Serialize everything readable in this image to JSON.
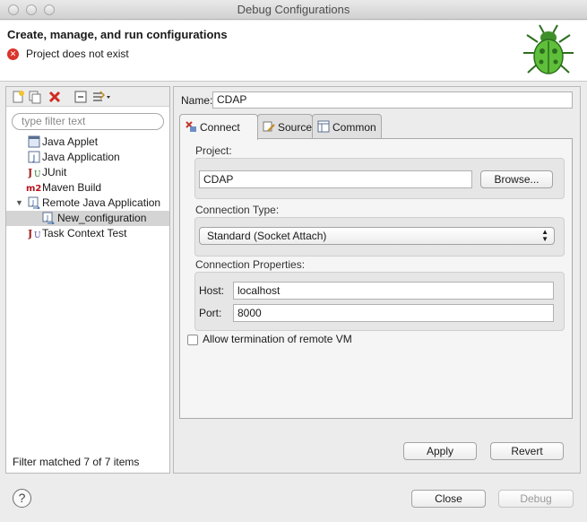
{
  "window": {
    "title": "Debug Configurations"
  },
  "header": {
    "title": "Create, manage, and run configurations",
    "message": "Project does not exist",
    "error_icon": "error-icon",
    "bug_icon": "debug-bug-icon"
  },
  "left": {
    "filter_placeholder": "type filter text",
    "toolbar": [
      "new-configuration-icon",
      "duplicate-icon",
      "delete-icon",
      "collapse-all-icon",
      "filter-icon"
    ],
    "tree": [
      {
        "label": "Java Applet",
        "icon": "java-applet-icon"
      },
      {
        "label": "Java Application",
        "icon": "java-application-icon"
      },
      {
        "label": "JUnit",
        "icon": "junit-icon"
      },
      {
        "label": "Maven Build",
        "icon": "maven-icon"
      },
      {
        "label": "Remote Java Application",
        "icon": "remote-java-icon",
        "expanded": true
      },
      {
        "label": "New_configuration",
        "icon": "remote-config-icon",
        "selected": true
      },
      {
        "label": "Task Context Test",
        "icon": "task-context-icon"
      }
    ],
    "status": "Filter matched 7 of 7 items"
  },
  "right": {
    "name_label": "Name:",
    "name_value": "CDAP",
    "tabs": [
      {
        "label": "Connect",
        "icon": "connect-icon",
        "active": true
      },
      {
        "label": "Source",
        "icon": "source-icon"
      },
      {
        "label": "Common",
        "icon": "common-icon"
      }
    ],
    "project_label": "Project:",
    "project_value": "CDAP",
    "browse_label": "Browse...",
    "connection_type_label": "Connection Type:",
    "connection_type_value": "Standard (Socket Attach)",
    "connection_props_label": "Connection Properties:",
    "host_label": "Host:",
    "host_value": "localhost",
    "port_label": "Port:",
    "port_value": "8000",
    "allow_termination_label": "Allow termination of remote VM",
    "allow_termination_checked": false,
    "apply_label": "Apply",
    "revert_label": "Revert"
  },
  "footer": {
    "help": "?",
    "close_label": "Close",
    "debug_label": "Debug"
  }
}
